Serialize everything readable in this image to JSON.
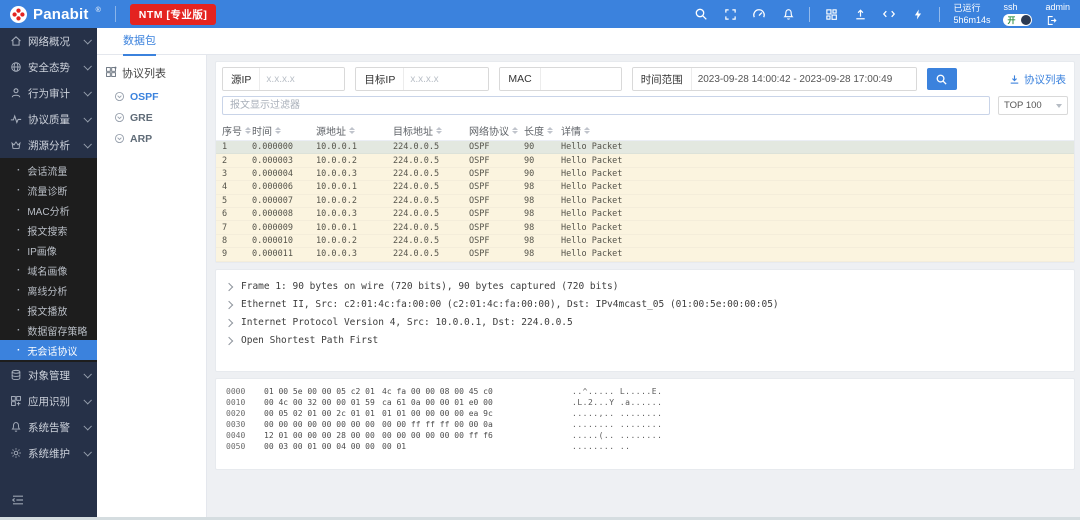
{
  "topbar": {
    "brand": "Panabit",
    "reg_mark": "®",
    "edition_badge": "NTM [专业版]",
    "uptime_label": "已运行",
    "uptime_value": "5h6m14s",
    "ssh_label": "ssh",
    "ssh_toggle_state": "开",
    "username": "admin"
  },
  "tabs": {
    "active": "数据包"
  },
  "sidebar": {
    "menu_top": [
      {
        "label": "网络概况",
        "icon": "home"
      },
      {
        "label": "安全态势",
        "icon": "globe"
      },
      {
        "label": "行为审计",
        "icon": "user"
      },
      {
        "label": "协议质量",
        "icon": "activity"
      },
      {
        "label": "溯源分析",
        "icon": "trace"
      }
    ],
    "submenu": [
      {
        "label": "会话流量"
      },
      {
        "label": "流量诊断"
      },
      {
        "label": "MAC分析"
      },
      {
        "label": "报文搜索"
      },
      {
        "label": "IP画像"
      },
      {
        "label": "域名画像"
      },
      {
        "label": "离线分析"
      },
      {
        "label": "报文播放"
      },
      {
        "label": "数据留存策略"
      },
      {
        "label": "无会话协议",
        "active": true
      }
    ],
    "menu_bottom": [
      {
        "label": "对象管理",
        "icon": "database"
      },
      {
        "label": "应用识别",
        "icon": "apps"
      },
      {
        "label": "系统告警",
        "icon": "bell"
      },
      {
        "label": "系统维护",
        "icon": "gear"
      }
    ]
  },
  "protocol_panel": {
    "title": "协议列表",
    "items": [
      {
        "label": "OSPF",
        "active": true
      },
      {
        "label": "GRE"
      },
      {
        "label": "ARP"
      }
    ]
  },
  "toolbar": {
    "src_ip_label": "源IP",
    "src_ip_placeholder": "x.x.x.x",
    "dst_ip_label": "目标IP",
    "dst_ip_placeholder": "x.x.x.x",
    "mac_label": "MAC",
    "time_label": "时间范围",
    "time_value": "2023-09-28 14:00:42 - 2023-09-28 17:00:49",
    "protocol_list_link": "协议列表",
    "display_filter_placeholder": "报文显示过滤器",
    "top_select_value": "TOP 100"
  },
  "packet_table": {
    "columns": [
      "序号",
      "时间",
      "源地址",
      "目标地址",
      "网络协议",
      "长度",
      "详情"
    ],
    "rows": [
      {
        "no": "1",
        "time": "0.000000",
        "src": "10.0.0.1",
        "dst": "224.0.0.5",
        "proto": "OSPF",
        "len": "90",
        "info": "Hello Packet",
        "selected": true
      },
      {
        "no": "2",
        "time": "0.000003",
        "src": "10.0.0.2",
        "dst": "224.0.0.5",
        "proto": "OSPF",
        "len": "90",
        "info": "Hello Packet"
      },
      {
        "no": "3",
        "time": "0.000004",
        "src": "10.0.0.3",
        "dst": "224.0.0.5",
        "proto": "OSPF",
        "len": "90",
        "info": "Hello Packet"
      },
      {
        "no": "4",
        "time": "0.000006",
        "src": "10.0.0.1",
        "dst": "224.0.0.5",
        "proto": "OSPF",
        "len": "98",
        "info": "Hello Packet"
      },
      {
        "no": "5",
        "time": "0.000007",
        "src": "10.0.0.2",
        "dst": "224.0.0.5",
        "proto": "OSPF",
        "len": "98",
        "info": "Hello Packet"
      },
      {
        "no": "6",
        "time": "0.000008",
        "src": "10.0.0.3",
        "dst": "224.0.0.5",
        "proto": "OSPF",
        "len": "98",
        "info": "Hello Packet"
      },
      {
        "no": "7",
        "time": "0.000009",
        "src": "10.0.0.1",
        "dst": "224.0.0.5",
        "proto": "OSPF",
        "len": "98",
        "info": "Hello Packet"
      },
      {
        "no": "8",
        "time": "0.000010",
        "src": "10.0.0.2",
        "dst": "224.0.0.5",
        "proto": "OSPF",
        "len": "98",
        "info": "Hello Packet"
      },
      {
        "no": "9",
        "time": "0.000011",
        "src": "10.0.0.3",
        "dst": "224.0.0.5",
        "proto": "OSPF",
        "len": "98",
        "info": "Hello Packet"
      }
    ]
  },
  "packet_detail": {
    "lines": [
      "Frame 1: 90 bytes on wire (720 bits), 90 bytes captured (720 bits)",
      "Ethernet II, Src: c2:01:4c:fa:00:00 (c2:01:4c:fa:00:00), Dst: IPv4mcast_05 (01:00:5e:00:00:05)",
      "Internet Protocol Version 4, Src: 10.0.0.1, Dst: 224.0.0.5",
      "Open Shortest Path First"
    ]
  },
  "hex_dump": {
    "rows": [
      {
        "offset": "0000",
        "hex1": "01 00 5e 00 00 05 c2 01",
        "hex2": "4c fa 00 00 08 00 45 c0",
        "ascii": "..^..... L.....E."
      },
      {
        "offset": "0010",
        "hex1": "00 4c 00 32 00 00 01 59",
        "hex2": "ca 61 0a 00 00 01 e0 00",
        "ascii": ".L.2...Y .a......"
      },
      {
        "offset": "0020",
        "hex1": "00 05 02 01 00 2c 01 01",
        "hex2": "01 01 00 00 00 00 ea 9c",
        "ascii": ".....,.. ........"
      },
      {
        "offset": "0030",
        "hex1": "00 00 00 00 00 00 00 00",
        "hex2": "00 00 ff ff ff 00 00 0a",
        "ascii": "........ ........"
      },
      {
        "offset": "0040",
        "hex1": "12 01 00 00 00 28 00 00",
        "hex2": "00 00 00 00 00 00 ff f6",
        "ascii": ".....(.. ........"
      },
      {
        "offset": "0050",
        "hex1": "00 03 00 01 00 04 00 00",
        "hex2": "00 01",
        "ascii": "........ .."
      }
    ]
  },
  "colors": {
    "topbar_blue": "#3b82dd",
    "badge_red": "#e42320",
    "sidebar_navy": "#263148",
    "submenu_dark": "#1d1d1d",
    "accent_blue": "#3b82dd",
    "row_cream": "#fbf4df",
    "row_selected": "#e3e8e0"
  }
}
